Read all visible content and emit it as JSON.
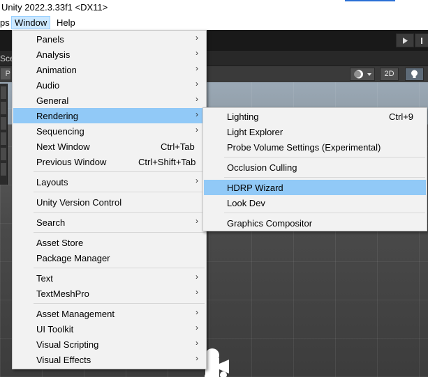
{
  "window": {
    "title": "Unity 2022.3.33f1 <DX11>"
  },
  "menubar": {
    "partial": "ps",
    "window": "Window",
    "help": "Help"
  },
  "editor": {
    "scene_tab_partial": "Sce",
    "persp_partial": "P",
    "view_2d": "2D",
    "accent_color": "#2a6fd6"
  },
  "window_menu": {
    "panels": "Panels",
    "analysis": "Analysis",
    "animation": "Animation",
    "audio": "Audio",
    "general": "General",
    "rendering": "Rendering",
    "sequencing": "Sequencing",
    "next_window": "Next Window",
    "next_window_shortcut": "Ctrl+Tab",
    "previous_window": "Previous Window",
    "previous_window_shortcut": "Ctrl+Shift+Tab",
    "layouts": "Layouts",
    "unity_version_control": "Unity Version Control",
    "search": "Search",
    "asset_store": "Asset Store",
    "package_manager": "Package Manager",
    "text": "Text",
    "textmeshpro": "TextMeshPro",
    "asset_management": "Asset Management",
    "ui_toolkit": "UI Toolkit",
    "visual_scripting": "Visual Scripting",
    "visual_effects": "Visual Effects"
  },
  "rendering_submenu": {
    "lighting": "Lighting",
    "lighting_shortcut": "Ctrl+9",
    "light_explorer": "Light Explorer",
    "probe_volume_settings": "Probe Volume Settings (Experimental)",
    "occlusion_culling": "Occlusion Culling",
    "hdrp_wizard": "HDRP Wizard",
    "look_dev": "Look Dev",
    "graphics_compositor": "Graphics Compositor"
  },
  "colors": {
    "highlight": "#91c9f7",
    "menu_background": "#f2f2f2"
  }
}
